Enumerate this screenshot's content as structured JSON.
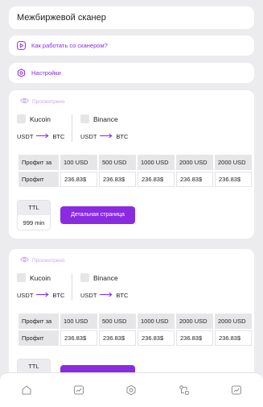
{
  "header": {
    "title": "Межбиржевой сканер"
  },
  "links": [
    {
      "label": "Как работать со сканером?",
      "icon": "play-icon"
    },
    {
      "label": "Настройки",
      "icon": "settings-icon"
    }
  ],
  "colors": {
    "accent": "#8a2be2",
    "background": "#ececef",
    "muted_accent": "#c9a6ef"
  },
  "cards": [
    {
      "seen_label": "Просмотрено",
      "exchange_a": {
        "name": "Kucoin",
        "from": "USDT",
        "to": "BTC"
      },
      "exchange_b": {
        "name": "Binance",
        "from": "USDT",
        "to": "BTC"
      },
      "table": {
        "row_label_header": "Профит за",
        "columns": [
          "100 USD",
          "500 USD",
          "1000 USD",
          "2000 USD",
          "2000 USD"
        ],
        "row_label": "Профит",
        "values": [
          "236.83$",
          "236.83$",
          "236.83$",
          "236.83$",
          "236.83$"
        ]
      },
      "ttl_label": "TTL",
      "ttl_value": "999 min",
      "detail_button": "Детальная страница"
    },
    {
      "seen_label": "Просмотрено",
      "exchange_a": {
        "name": "Kucoin",
        "from": "USDT",
        "to": "BTC"
      },
      "exchange_b": {
        "name": "Binance",
        "from": "USDT",
        "to": "BTC"
      },
      "table": {
        "row_label_header": "Профит за",
        "columns": [
          "100 USD",
          "500 USD",
          "1000 USD",
          "2000 USD",
          "2000 USD"
        ],
        "row_label": "Профит",
        "values": [
          "236.83$",
          "236.83$",
          "236.83$",
          "236.83$",
          "236.83$"
        ]
      },
      "ttl_label": "TTL",
      "ttl_value": "",
      "detail_button": ""
    }
  ],
  "bottom_nav": [
    "home-icon",
    "chart-icon",
    "settings-icon",
    "exchange-icon",
    "chart-icon"
  ]
}
